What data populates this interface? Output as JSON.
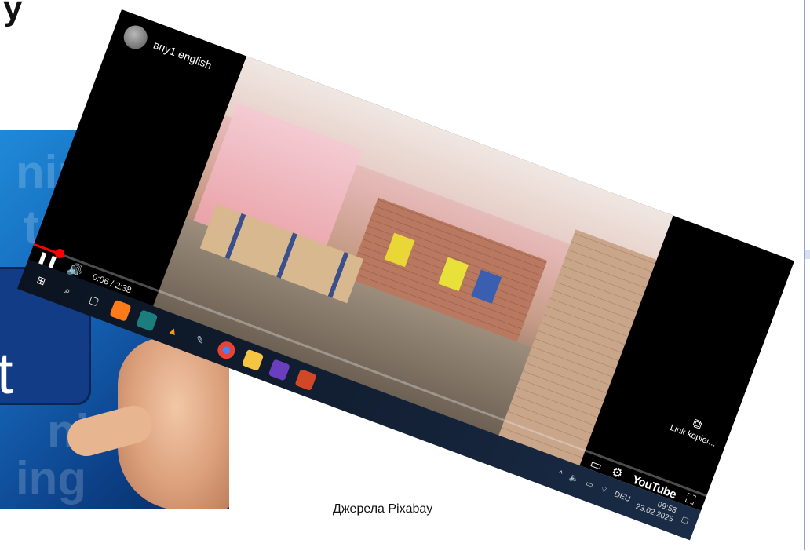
{
  "heading_fragment": "y",
  "video": {
    "channel_name": "впу1 english",
    "time_display": "0:06 / 2:38",
    "progress": 0.038,
    "link_copy_label": "Link kopier...",
    "brand": "YouTube"
  },
  "taskbar": {
    "language": "DEU",
    "time": "09:53",
    "date": "23.02.2025"
  },
  "caption": "Джерела Pixabay",
  "puzzle": {
    "letter": "t"
  },
  "colors": {
    "progress": "#ff0000",
    "taskbar": "#0b1320",
    "puzzle_bg": "#1565b8"
  }
}
